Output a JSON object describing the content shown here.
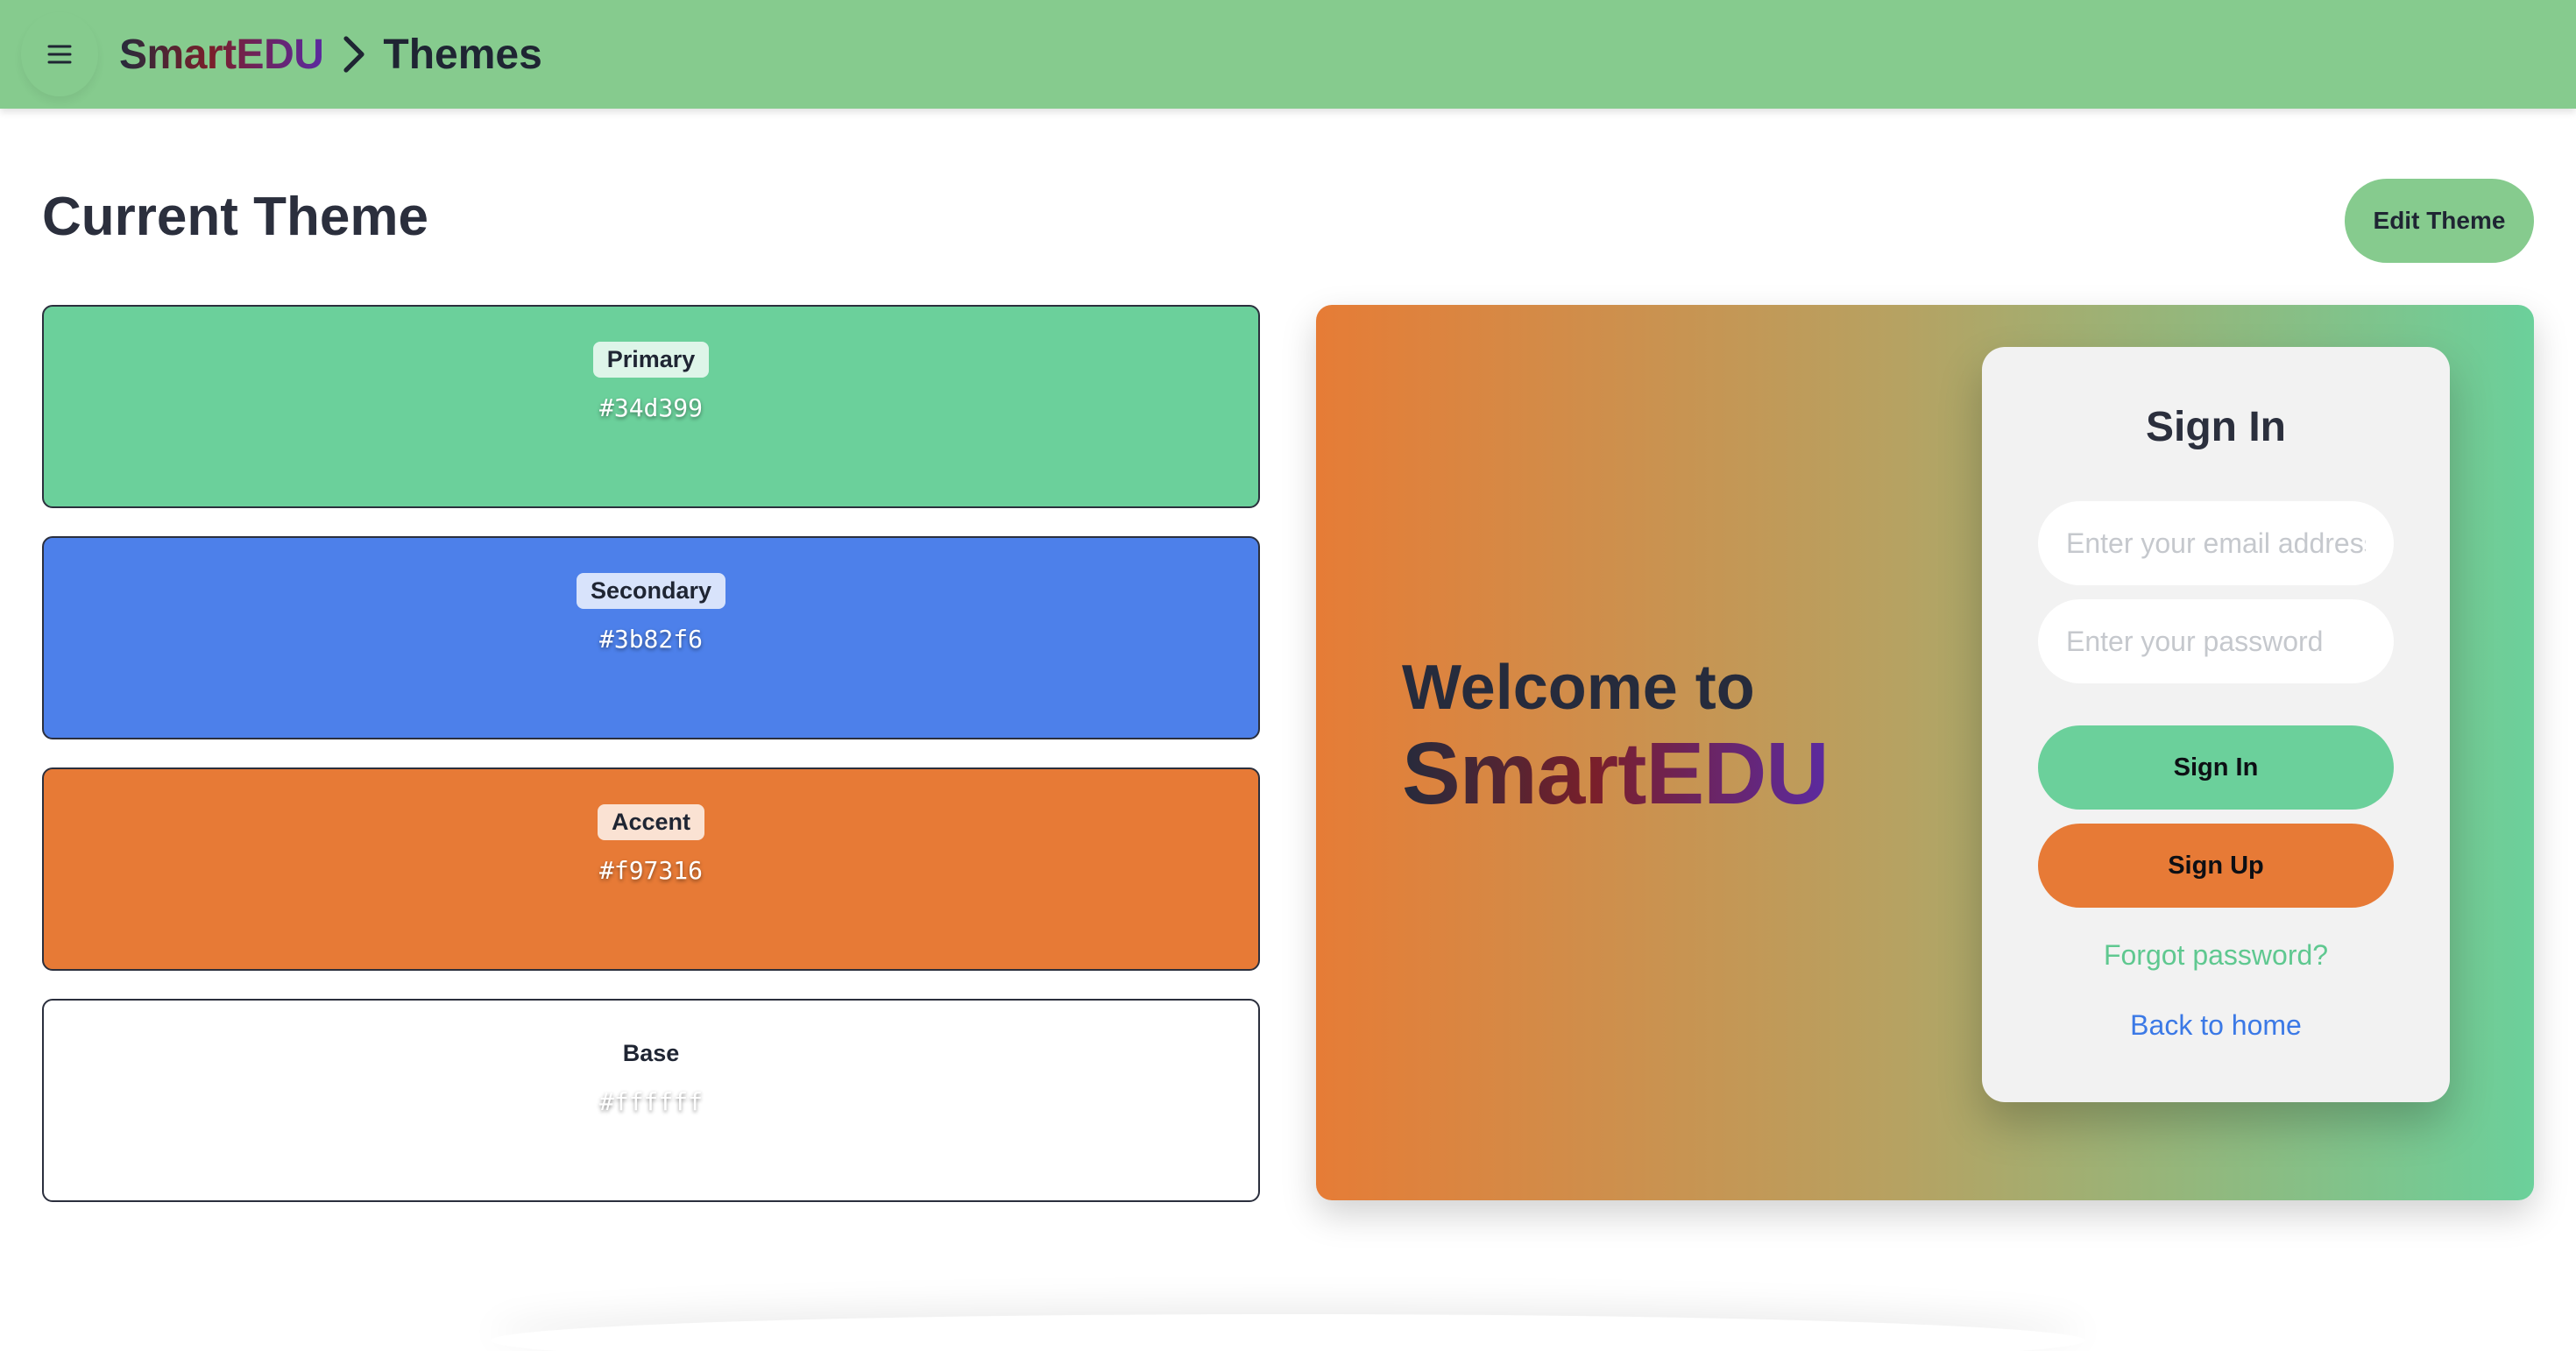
{
  "header": {
    "brand": "SmartEDU",
    "page": "Themes"
  },
  "main": {
    "title": "Current Theme",
    "edit_label": "Edit Theme"
  },
  "swatches": [
    {
      "label": "Primary",
      "hex": "#34d399"
    },
    {
      "label": "Secondary",
      "hex": "#3b82f6"
    },
    {
      "label": "Accent",
      "hex": "#f97316"
    },
    {
      "label": "Base",
      "hex": "#ffffff"
    }
  ],
  "preview": {
    "welcome": "Welcome to",
    "brand": "SmartEDU",
    "signin_title": "Sign In",
    "email_placeholder": "Enter your email address",
    "password_placeholder": "Enter your password",
    "signin_label": "Sign In",
    "signup_label": "Sign Up",
    "forgot_label": "Forgot password?",
    "home_label": "Back to home"
  },
  "colors": {
    "topbar": "#86cb8e",
    "primary": "#34d399",
    "secondary": "#3b82f6",
    "accent": "#f97316",
    "base": "#ffffff"
  },
  "icons": {
    "menu": "hamburger-icon",
    "separator": "chevron-right-icon"
  }
}
